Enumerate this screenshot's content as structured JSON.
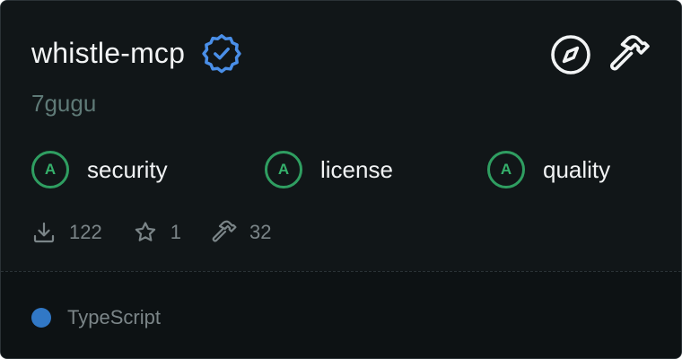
{
  "server": {
    "name": "whistle-mcp",
    "owner": "7gugu",
    "verified_icon": "verified-badge-icon",
    "actions": [
      {
        "icon": "compass-icon"
      },
      {
        "icon": "hammer-icon"
      }
    ]
  },
  "grades": [
    {
      "grade": "A",
      "label": "security"
    },
    {
      "grade": "A",
      "label": "license"
    },
    {
      "grade": "A",
      "label": "quality"
    }
  ],
  "stats": [
    {
      "icon": "download-icon",
      "value": "122"
    },
    {
      "icon": "star-icon",
      "value": "1"
    },
    {
      "icon": "hammer-icon",
      "value": "32"
    }
  ],
  "language": {
    "name": "TypeScript",
    "color": "#3178c6"
  },
  "colors": {
    "card_background": "#111618",
    "footer_background": "#0d1214",
    "verified_blue": "#4a8fe8",
    "grade_green": "#2f9e61"
  }
}
